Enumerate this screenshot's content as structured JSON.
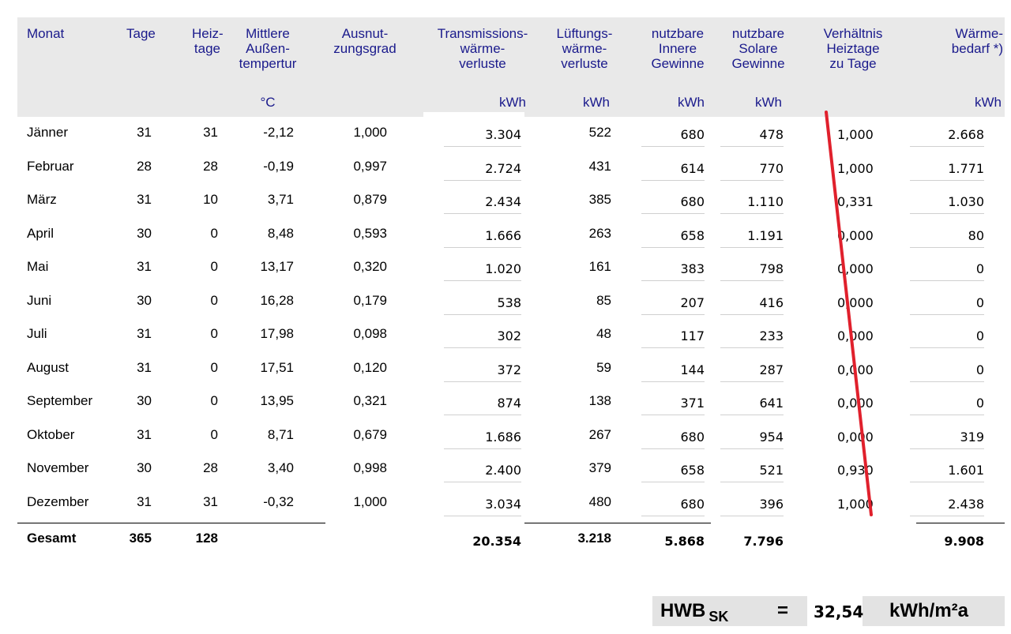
{
  "headers": {
    "monat": "Monat",
    "tage": "Tage",
    "heiztage_1": "Heiz-",
    "heiztage_2": "tage",
    "temp_1": "Mittlere",
    "temp_2": "Außen-",
    "temp_3": "tempertur",
    "temp_unit": "°C",
    "ausnutz_1": "Ausnut-",
    "ausnutz_2": "zungsgrad",
    "trans_1": "Transmissions-",
    "trans_2": "wärme-",
    "trans_3": "verluste",
    "trans_unit": "kWh",
    "lueft_1": "Lüftungs-",
    "lueft_2": "wärme-",
    "lueft_3": "verluste",
    "lueft_unit": "kWh",
    "inner_1": "nutzbare",
    "inner_2": "Innere",
    "inner_3": "Gewinne",
    "inner_unit": "kWh",
    "solar_1": "nutzbare",
    "solar_2": "Solare",
    "solar_3": "Gewinne",
    "solar_unit": "kWh",
    "verh_1": "Verhältnis",
    "verh_2": "Heiztage",
    "verh_3": "zu Tage",
    "bedarf_1": "Wärme-",
    "bedarf_2": "bedarf *)",
    "bedarf_unit": "kWh"
  },
  "rows": [
    {
      "monat": "Jänner",
      "tage": "31",
      "heiztage": "31",
      "temp": "-2,12",
      "ausnutz": "1,000",
      "trans": "3.304",
      "lueft": "522",
      "inner": "680",
      "solar": "478",
      "verh": "1,000",
      "bedarf": "2.668"
    },
    {
      "monat": "Februar",
      "tage": "28",
      "heiztage": "28",
      "temp": "-0,19",
      "ausnutz": "0,997",
      "trans": "2.724",
      "lueft": "431",
      "inner": "614",
      "solar": "770",
      "verh": "1,000",
      "bedarf": "1.771"
    },
    {
      "monat": "März",
      "tage": "31",
      "heiztage": "10",
      "temp": "3,71",
      "ausnutz": "0,879",
      "trans": "2.434",
      "lueft": "385",
      "inner": "680",
      "solar": "1.110",
      "verh": "0,331",
      "bedarf": "1.030"
    },
    {
      "monat": "April",
      "tage": "30",
      "heiztage": "0",
      "temp": "8,48",
      "ausnutz": "0,593",
      "trans": "1.666",
      "lueft": "263",
      "inner": "658",
      "solar": "1.191",
      "verh": "0,000",
      "bedarf": "80"
    },
    {
      "monat": "Mai",
      "tage": "31",
      "heiztage": "0",
      "temp": "13,17",
      "ausnutz": "0,320",
      "trans": "1.020",
      "lueft": "161",
      "inner": "383",
      "solar": "798",
      "verh": "0,000",
      "bedarf": "0"
    },
    {
      "monat": "Juni",
      "tage": "30",
      "heiztage": "0",
      "temp": "16,28",
      "ausnutz": "0,179",
      "trans": "538",
      "lueft": "85",
      "inner": "207",
      "solar": "416",
      "verh": "0,000",
      "bedarf": "0"
    },
    {
      "monat": "Juli",
      "tage": "31",
      "heiztage": "0",
      "temp": "17,98",
      "ausnutz": "0,098",
      "trans": "302",
      "lueft": "48",
      "inner": "117",
      "solar": "233",
      "verh": "0,000",
      "bedarf": "0"
    },
    {
      "monat": "August",
      "tage": "31",
      "heiztage": "0",
      "temp": "17,51",
      "ausnutz": "0,120",
      "trans": "372",
      "lueft": "59",
      "inner": "144",
      "solar": "287",
      "verh": "0,000",
      "bedarf": "0"
    },
    {
      "monat": "September",
      "tage": "30",
      "heiztage": "0",
      "temp": "13,95",
      "ausnutz": "0,321",
      "trans": "874",
      "lueft": "138",
      "inner": "371",
      "solar": "641",
      "verh": "0,000",
      "bedarf": "0"
    },
    {
      "monat": "Oktober",
      "tage": "31",
      "heiztage": "0",
      "temp": "8,71",
      "ausnutz": "0,679",
      "trans": "1.686",
      "lueft": "267",
      "inner": "680",
      "solar": "954",
      "verh": "0,000",
      "bedarf": "319"
    },
    {
      "monat": "November",
      "tage": "30",
      "heiztage": "28",
      "temp": "3,40",
      "ausnutz": "0,998",
      "trans": "2.400",
      "lueft": "379",
      "inner": "658",
      "solar": "521",
      "verh": "0,930",
      "bedarf": "1.601"
    },
    {
      "monat": "Dezember",
      "tage": "31",
      "heiztage": "31",
      "temp": "-0,32",
      "ausnutz": "1,000",
      "trans": "3.034",
      "lueft": "480",
      "inner": "680",
      "solar": "396",
      "verh": "1,000",
      "bedarf": "2.438"
    }
  ],
  "total": {
    "monat": "Gesamt",
    "tage": "365",
    "heiztage": "128",
    "trans": "20.354",
    "lueft": "3.218",
    "inner": "5.868",
    "solar": "7.796",
    "bedarf": "9.908"
  },
  "hwb": {
    "label": "HWB",
    "sub": "SK",
    "equals": "=",
    "value": "32,54",
    "unit": "kWh/m²a"
  },
  "colors": {
    "header_text": "#1a1a8c",
    "header_band": "#e9e9e9",
    "red_stroke": "#e0202c"
  }
}
